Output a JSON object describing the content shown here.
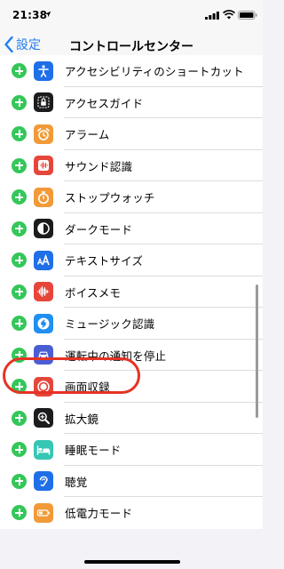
{
  "status_bar": {
    "time": "21:38"
  },
  "nav": {
    "back_label": "設定",
    "title": "コントロールセンター"
  },
  "items": [
    {
      "label": "アクセシビリティのショートカット",
      "icon": "accessibility-icon",
      "color": "#1f6fe8"
    },
    {
      "label": "アクセスガイド",
      "icon": "lock-icon",
      "color": "#1c1c1e"
    },
    {
      "label": "アラーム",
      "icon": "alarm-clock-icon",
      "color": "#f19a37"
    },
    {
      "label": "サウンド認識",
      "icon": "waveform-icon",
      "color": "#e6463a"
    },
    {
      "label": "ストップウォッチ",
      "icon": "stopwatch-icon",
      "color": "#f19a37"
    },
    {
      "label": "ダークモード",
      "icon": "dark-mode-icon",
      "color": "#1c1c1e"
    },
    {
      "label": "テキストサイズ",
      "icon": "text-size-icon",
      "color": "#1f6fe8"
    },
    {
      "label": "ボイスメモ",
      "icon": "voice-memo-icon",
      "color": "#e6463a"
    },
    {
      "label": "ミュージック認識",
      "icon": "shazam-icon",
      "color": "#1f8ff2"
    },
    {
      "label": "運転中の通知を停止",
      "icon": "car-icon",
      "color": "#4a5ed3"
    },
    {
      "label": "画面収録",
      "icon": "screen-record-icon",
      "color": "#e6463a"
    },
    {
      "label": "拡大鏡",
      "icon": "magnifier-icon",
      "color": "#1c1c1e"
    },
    {
      "label": "睡眠モード",
      "icon": "bed-icon",
      "color": "#36c6b4"
    },
    {
      "label": "聴覚",
      "icon": "ear-icon",
      "color": "#1f6fe8"
    },
    {
      "label": "低電力モード",
      "icon": "battery-low-icon",
      "color": "#f19a37"
    }
  ],
  "highlight": {
    "color": "#e53324",
    "target": "画面収録"
  }
}
